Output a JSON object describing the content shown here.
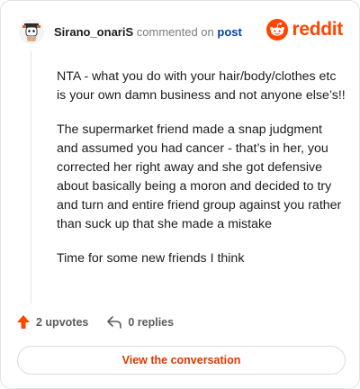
{
  "header": {
    "username": "Sirano_onariS",
    "action": "commented on",
    "target": "post",
    "brand": "reddit"
  },
  "comment": {
    "paragraphs": [
      "NTA - what you do with your hair/body/clothes etc is your own damn business and not anyone else’s!!",
      "The supermarket friend made a snap judgment and assumed you had cancer - that’s in her, you corrected her right away and she got defensive about basically being a moron and decided to try and turn and entire friend group against you rather than suck up that she made a mistake",
      "Time for some new friends I think"
    ]
  },
  "footer": {
    "upvotes": "2 upvotes",
    "replies": "0 replies",
    "cta": "View the conversation"
  },
  "colors": {
    "brand": "#ff4500",
    "link": "#0045ac",
    "cta_text": "#d93900"
  },
  "icons": {
    "avatar": "avatar-snoo",
    "upvote": "upvote-arrow-icon",
    "reply": "reply-arrow-icon",
    "logo": "reddit-snoo-logo-icon"
  }
}
